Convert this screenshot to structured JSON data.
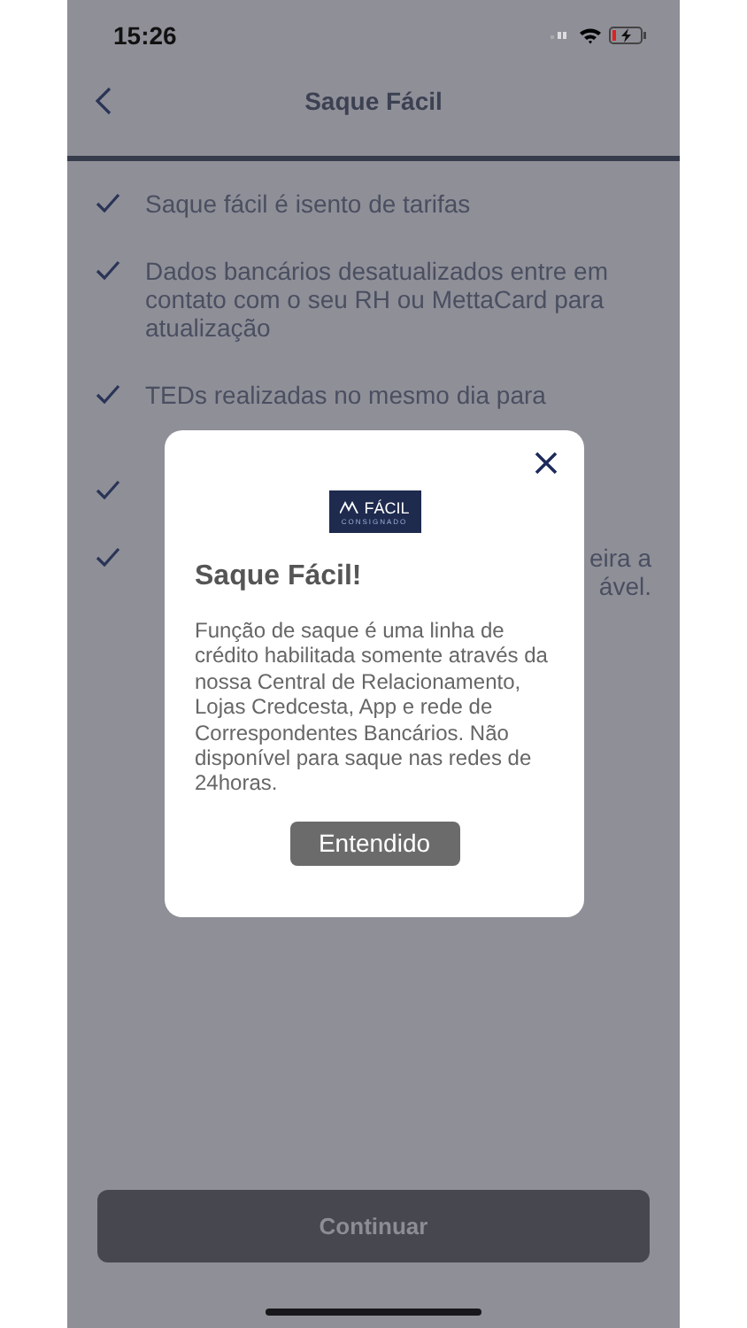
{
  "status_bar": {
    "time": "15:26"
  },
  "header": {
    "title": "Saque Fácil"
  },
  "items": [
    {
      "kind": "full",
      "lines": [
        "Saque fácil é isento de tarifas"
      ]
    },
    {
      "kind": "full",
      "lines": [
        "Dados bancários desatualizados entre em contato com o seu RH ou MettaCard para atualização"
      ]
    },
    {
      "kind": "full",
      "lines": [
        "TEDs realizadas no mesmo dia para"
      ]
    },
    {
      "kind": "hidden"
    },
    {
      "kind": "fragment",
      "lines": [
        "eira a",
        "ável."
      ]
    }
  ],
  "continue_button": {
    "label": "Continuar",
    "disabled": true
  },
  "modal": {
    "logo": {
      "word": "FÁCIL",
      "subtitle": "CONSIGNADO"
    },
    "title": "Saque Fácil!",
    "body": "Função de saque é uma linha de crédito habilitada somente através da nossa Central de Relacionamento, Lojas Credcesta, App e rede de Correspondentes Bancários. Não disponível para saque nas redes de 24horas.",
    "button": "Entendido"
  }
}
